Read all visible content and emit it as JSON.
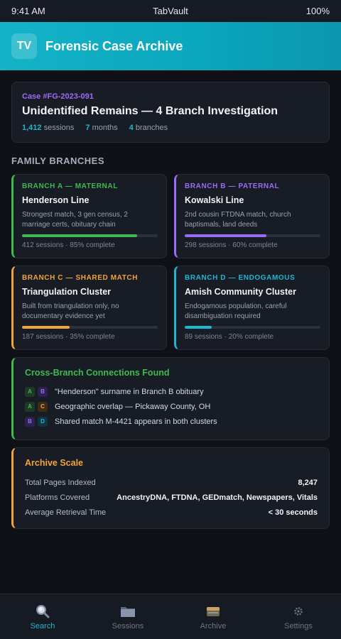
{
  "status_bar": {
    "time": "9:41 AM",
    "carrier": "TabVault",
    "battery": "100%"
  },
  "header": {
    "logo": "TV",
    "title": "Forensic Case Archive"
  },
  "case": {
    "id": "Case #FG-2023-091",
    "title": "Unidentified Remains — 4 Branch Investigation",
    "stats": [
      {
        "value": "1,412",
        "label": "sessions"
      },
      {
        "value": "7",
        "label": "months"
      },
      {
        "value": "4",
        "label": "branches"
      }
    ]
  },
  "branches_section": {
    "title": "FAMILY BRANCHES"
  },
  "branches": [
    {
      "label": "BRANCH A — MATERNAL",
      "name": "Henderson Line",
      "desc": "Strongest match, 3 gen census, 2 marriage certs, obituary chain",
      "progress": 0.85,
      "meta": "412 sessions · 85% complete",
      "color": "#3fb950"
    },
    {
      "label": "BRANCH B — PATERNAL",
      "name": "Kowalski Line",
      "desc": "2nd cousin FTDNA match, church baptismals, land deeds",
      "progress": 0.6,
      "meta": "298 sessions · 60% complete",
      "color": "#9b6cf6"
    },
    {
      "label": "BRANCH C — SHARED MATCH",
      "name": "Triangulation Cluster",
      "desc": "Built from triangulation only, no documentary evidence yet",
      "progress": 0.35,
      "meta": "187 sessions · 35% complete",
      "color": "#f2a43a"
    },
    {
      "label": "BRANCH D — ENDOGAMOUS",
      "name": "Amish Community Cluster",
      "desc": "Endogamous population, careful disambiguation required",
      "progress": 0.2,
      "meta": "89 sessions · 20% complete",
      "color": "#1fb6d1"
    }
  ],
  "connections": {
    "title": "Cross-Branch Connections Found",
    "items": [
      {
        "chips": [
          "A",
          "B"
        ],
        "text": "\"Henderson\" surname in Branch B obituary"
      },
      {
        "chips": [
          "A",
          "C"
        ],
        "text": "Geographic overlap — Pickaway County, OH"
      },
      {
        "chips": [
          "B",
          "D"
        ],
        "text": "Shared match M-4421 appears in both clusters"
      }
    ]
  },
  "scale": {
    "title": "Archive Scale",
    "rows": [
      {
        "key": "Total Pages Indexed",
        "value": "8,247"
      },
      {
        "key": "Platforms Covered",
        "value": "AncestryDNA, FTDNA, GEDmatch, Newspapers, Vitals"
      },
      {
        "key": "Average Retrieval Time",
        "value": "< 30 seconds"
      }
    ]
  },
  "tabbar": {
    "tabs": [
      {
        "label": "Search",
        "icon": "search-icon",
        "active": true
      },
      {
        "label": "Sessions",
        "icon": "folder-icon",
        "active": false
      },
      {
        "label": "Archive",
        "icon": "archive-box-icon",
        "active": false
      },
      {
        "label": "Settings",
        "icon": "gear-icon",
        "active": false
      }
    ]
  },
  "colors": {
    "accent": "#1fb6d1",
    "green": "#3fb950",
    "purple": "#9b6cf6",
    "orange": "#f2a43a"
  }
}
